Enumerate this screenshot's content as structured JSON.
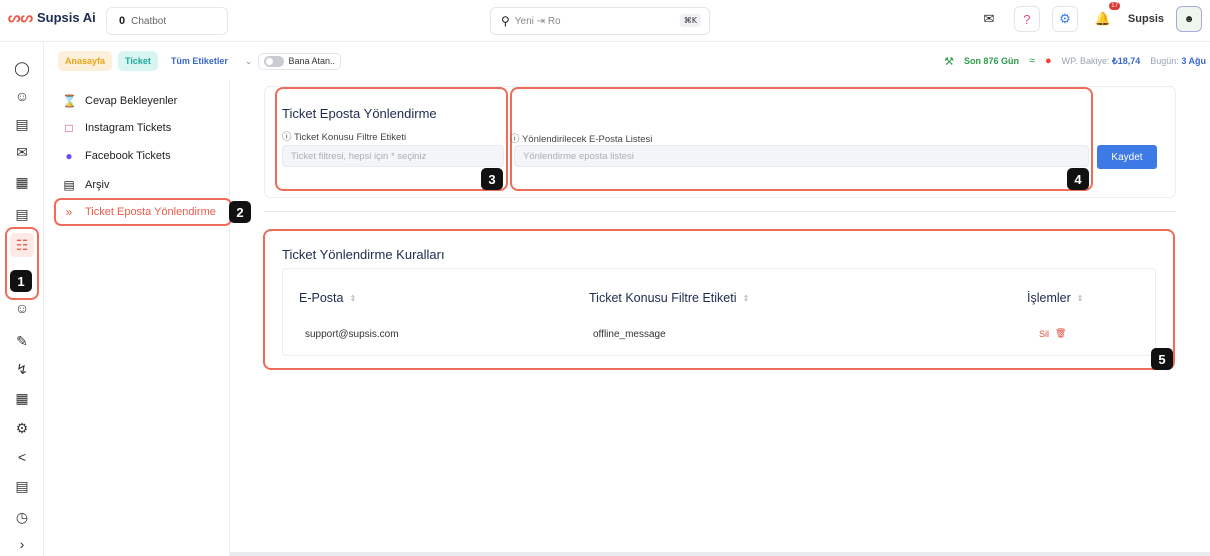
{
  "app": {
    "logo_text": "Supsis Ai",
    "chatbot_count": "0",
    "chatbot_label": "Chatbot"
  },
  "search": {
    "value": "Yeni ⇥ Ro",
    "shortcut": "⌘K"
  },
  "topbar": {
    "user": "Supsis",
    "notif_count": "17"
  },
  "subbar": {
    "home": "Anasayfa",
    "ticket": "Ticket",
    "tags": "Tüm Etiketler",
    "assigned": "Bana Atan..",
    "days": "Son 876 Gün",
    "balance_label": "WP. Bakiye:",
    "balance_value": "₺18,74",
    "today_label": "Bugün:",
    "today_value": "3 Ağu"
  },
  "menu": {
    "items": [
      {
        "label": "Cevap Bekleyenler",
        "icon": "hourglass-icon"
      },
      {
        "label": "Instagram Tickets",
        "icon": "instagram-icon"
      },
      {
        "label": "Facebook Tickets",
        "icon": "messenger-icon"
      },
      {
        "label": "Arşiv",
        "icon": "archive-icon"
      },
      {
        "label": "Ticket Eposta Yönlendirme",
        "icon": "double-chevron-icon"
      }
    ]
  },
  "routing": {
    "title": "Ticket Eposta Yönlendirme",
    "filter_label": "ⓘ Ticket Konusu Filtre Etiketi",
    "filter_placeholder": "Ticket filtresi, hepsi için * seçiniz",
    "email_label": "ⓘ Yönlendirilecek E-Posta Listesi",
    "email_placeholder": "Yönlendirme eposta listesi",
    "save": "Kaydet"
  },
  "rules": {
    "title": "Ticket Yönlendirme Kuralları",
    "columns": [
      "E-Posta",
      "Ticket Konusu Filtre Etiketi",
      "İşlemler"
    ],
    "rows": [
      {
        "email": "support@supsis.com",
        "tag": "offline_message",
        "action": "Sil"
      }
    ]
  },
  "markers": [
    "1",
    "2",
    "3",
    "4",
    "5"
  ],
  "colors": {
    "accent": "#ef6c58",
    "primary": "#3d7ae6"
  }
}
